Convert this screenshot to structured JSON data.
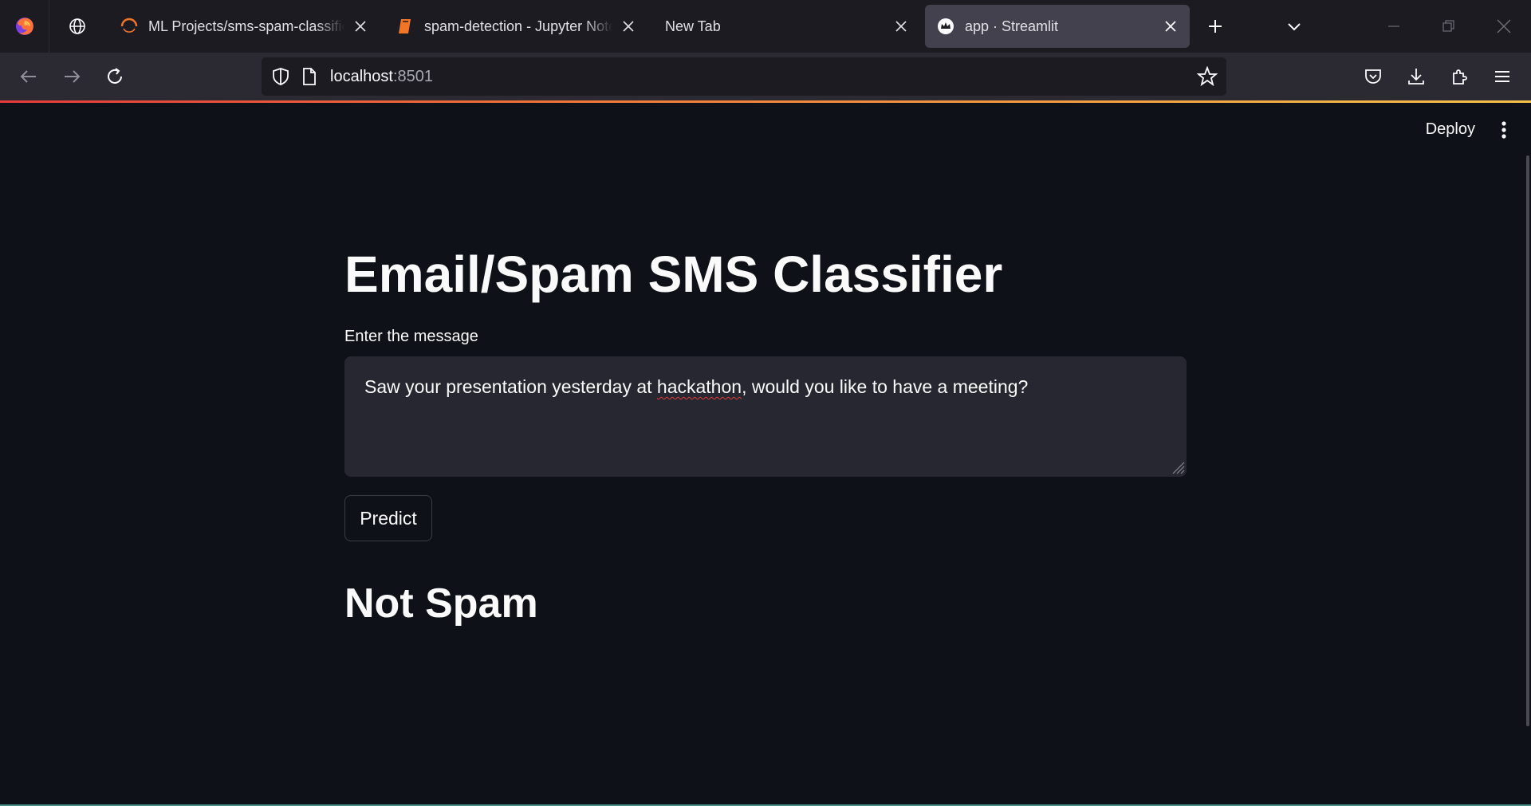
{
  "browser": {
    "tabs": [
      {
        "label": "ML Projects/sms-spam-classifier",
        "icon": "loading-spinner-icon"
      },
      {
        "label": "spam-detection - Jupyter Notebook",
        "icon": "jupyter-book-icon"
      },
      {
        "label": "New Tab",
        "icon": ""
      },
      {
        "label": "app · Streamlit",
        "icon": "streamlit-crown-icon",
        "active": true
      }
    ],
    "url": {
      "host": "localhost",
      "port": ":8501"
    },
    "accent_colors": {
      "chrome_bg": "#1c1b22",
      "nav_bg": "#2b2a33",
      "active_tab": "#42414d"
    }
  },
  "app": {
    "header": {
      "deploy_label": "Deploy"
    },
    "title": "Email/Spam SMS Classifier",
    "input_label": "Enter the message",
    "message": {
      "before": "Saw your presentation yesterday at ",
      "misspelled": "hackathon",
      "after": ", would you like to have a meeting?"
    },
    "predict_label": "Predict",
    "result": "Not Spam",
    "colors": {
      "bg": "#0e1117",
      "input_bg": "#262730",
      "text": "#fafafa"
    }
  }
}
